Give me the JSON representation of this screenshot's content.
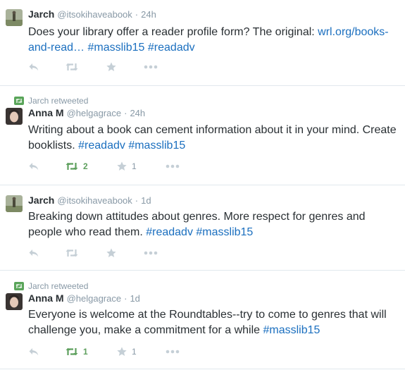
{
  "tweets": [
    {
      "retweeted_by": "",
      "name": "Jarch",
      "handle": "@itsokihaveabook",
      "time": "24h",
      "segments": [
        {
          "text": "Does your library offer a reader profile form? The original: ",
          "link": false
        },
        {
          "text": "wrl.org/books-and-read…",
          "link": true
        },
        {
          "text": " ",
          "link": false
        },
        {
          "text": "#masslib15",
          "link": true
        },
        {
          "text": " ",
          "link": false
        },
        {
          "text": "#readadv",
          "link": true
        }
      ],
      "retweets": "",
      "favorites": "",
      "retweeted": false
    },
    {
      "retweeted_by": "Jarch retweeted",
      "name": "Anna M",
      "handle": "@helgagrace",
      "time": "24h",
      "segments": [
        {
          "text": "Writing about a book can cement information about it in your mind. Create booklists. ",
          "link": false
        },
        {
          "text": "#readadv",
          "link": true
        },
        {
          "text": " ",
          "link": false
        },
        {
          "text": "#masslib15",
          "link": true
        }
      ],
      "retweets": "2",
      "favorites": "1",
      "retweeted": true
    },
    {
      "retweeted_by": "",
      "name": "Jarch",
      "handle": "@itsokihaveabook",
      "time": "1d",
      "segments": [
        {
          "text": "Breaking down attitudes about genres. More respect for genres and people who read them. ",
          "link": false
        },
        {
          "text": "#readadv",
          "link": true
        },
        {
          "text": " ",
          "link": false
        },
        {
          "text": "#masslib15",
          "link": true
        }
      ],
      "retweets": "",
      "favorites": "",
      "retweeted": false
    },
    {
      "retweeted_by": "Jarch retweeted",
      "name": "Anna M",
      "handle": "@helgagrace",
      "time": "1d",
      "segments": [
        {
          "text": "Everyone is welcome at the Roundtables--try to come to genres that will challenge you, make a commitment for a while ",
          "link": false
        },
        {
          "text": "#masslib15",
          "link": true
        }
      ],
      "retweets": "1",
      "favorites": "1",
      "retweeted": true
    }
  ],
  "icons": {
    "retweet_context": "retweet-icon",
    "reply": "reply-icon",
    "retweet": "retweet-icon",
    "favorite": "star-icon",
    "more": "more-icon"
  },
  "colors": {
    "link": "#1b6fbf",
    "retweet_active": "#5ea05e",
    "muted": "#8899a6",
    "text": "#292f33"
  }
}
